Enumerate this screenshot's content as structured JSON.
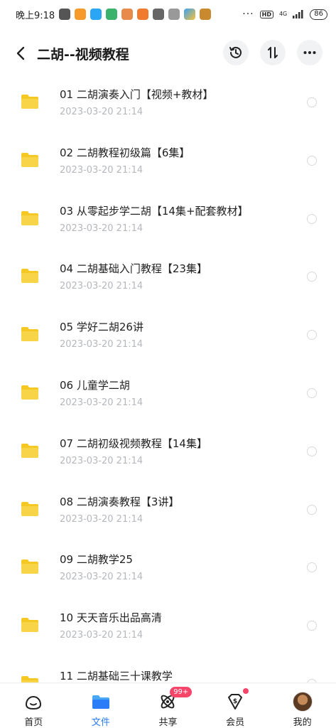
{
  "status_bar": {
    "time": "晚上9:18",
    "more": "···",
    "hd": "HD",
    "network": "4G",
    "battery": "86"
  },
  "header": {
    "title": "二胡--视频教程"
  },
  "files": [
    {
      "name": "01 二胡演奏入门【视频+教材】",
      "date": "2023-03-20  21:14"
    },
    {
      "name": "02 二胡教程初级篇【6集】",
      "date": "2023-03-20  21:14"
    },
    {
      "name": "03 从零起步学二胡【14集+配套教材】",
      "date": "2023-03-20  21:14"
    },
    {
      "name": "04 二胡基础入门教程【23集】",
      "date": "2023-03-20  21:14"
    },
    {
      "name": "05 学好二胡26讲",
      "date": "2023-03-20  21:14"
    },
    {
      "name": "06 儿童学二胡",
      "date": "2023-03-20  21:14"
    },
    {
      "name": "07 二胡初级视频教程【14集】",
      "date": "2023-03-20  21:14"
    },
    {
      "name": "08 二胡演奏教程【3讲】",
      "date": "2023-03-20  21:14"
    },
    {
      "name": "09 二胡教学25",
      "date": "2023-03-20  21:14"
    },
    {
      "name": "10 天天音乐出品高清",
      "date": "2023-03-20  21:14"
    },
    {
      "name": "11 二胡基础三十课教学",
      "date": ""
    }
  ],
  "tabbar": {
    "home": "首页",
    "files": "文件",
    "share": "共享",
    "share_badge": "99+",
    "vip": "会员",
    "me": "我的"
  },
  "colors": {
    "accent": "#2a7cf7",
    "folder": "#f8d548",
    "badge": "#f5466a"
  }
}
